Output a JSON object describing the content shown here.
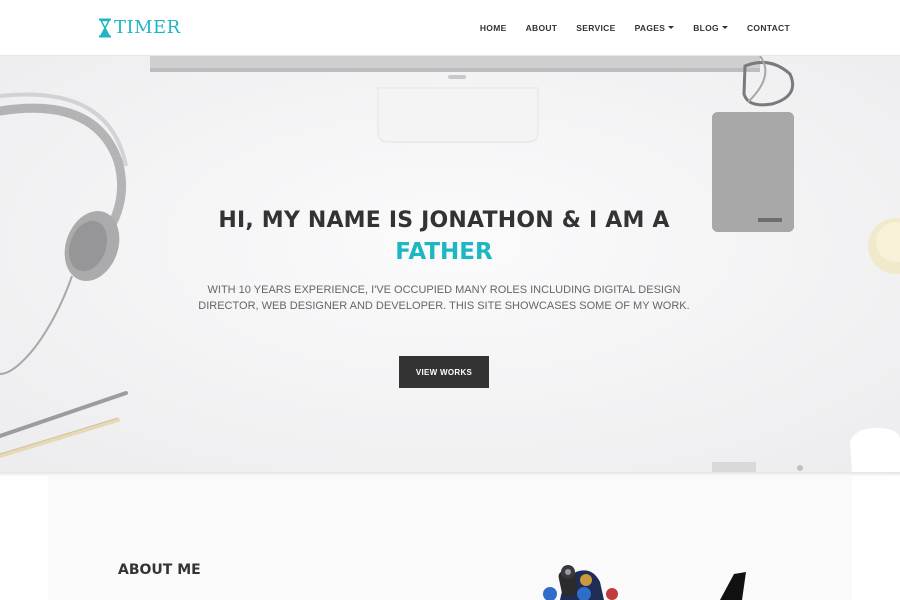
{
  "brand": {
    "name": "TIMER",
    "icon": "hourglass-icon",
    "accent_color": "#1fb6c4"
  },
  "nav": {
    "items": [
      {
        "label": "HOME",
        "dropdown": false
      },
      {
        "label": "ABOUT",
        "dropdown": false
      },
      {
        "label": "SERVICE",
        "dropdown": false
      },
      {
        "label": "PAGES",
        "dropdown": true
      },
      {
        "label": "BLOG",
        "dropdown": true
      },
      {
        "label": "CONTACT",
        "dropdown": false
      }
    ]
  },
  "hero": {
    "title": "HI, MY NAME IS JONATHON & I AM A",
    "role": "FATHER",
    "description": "WITH 10 YEARS EXPERIENCE, I'VE OCCUPIED MANY ROLES INCLUDING DIGITAL DESIGN DIRECTOR, WEB DESIGNER AND DEVELOPER. THIS SITE SHOWCASES SOME OF MY WORK.",
    "button_label": "VIEW WORKS",
    "button_color": "#333333"
  },
  "about": {
    "title": "ABOUT ME"
  }
}
